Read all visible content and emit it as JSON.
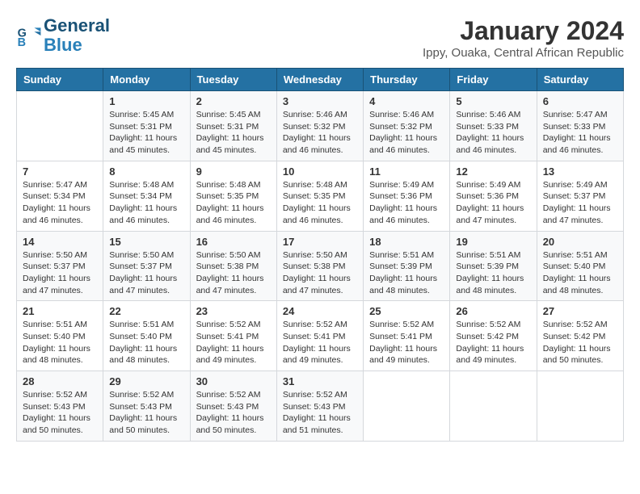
{
  "logo": {
    "line1": "General",
    "line2": "Blue"
  },
  "title": "January 2024",
  "subtitle": "Ippy, Ouaka, Central African Republic",
  "weekdays": [
    "Sunday",
    "Monday",
    "Tuesday",
    "Wednesday",
    "Thursday",
    "Friday",
    "Saturday"
  ],
  "weeks": [
    [
      {
        "day": "",
        "info": ""
      },
      {
        "day": "1",
        "info": "Sunrise: 5:45 AM\nSunset: 5:31 PM\nDaylight: 11 hours\nand 45 minutes."
      },
      {
        "day": "2",
        "info": "Sunrise: 5:45 AM\nSunset: 5:31 PM\nDaylight: 11 hours\nand 45 minutes."
      },
      {
        "day": "3",
        "info": "Sunrise: 5:46 AM\nSunset: 5:32 PM\nDaylight: 11 hours\nand 46 minutes."
      },
      {
        "day": "4",
        "info": "Sunrise: 5:46 AM\nSunset: 5:32 PM\nDaylight: 11 hours\nand 46 minutes."
      },
      {
        "day": "5",
        "info": "Sunrise: 5:46 AM\nSunset: 5:33 PM\nDaylight: 11 hours\nand 46 minutes."
      },
      {
        "day": "6",
        "info": "Sunrise: 5:47 AM\nSunset: 5:33 PM\nDaylight: 11 hours\nand 46 minutes."
      }
    ],
    [
      {
        "day": "7",
        "info": "Sunrise: 5:47 AM\nSunset: 5:34 PM\nDaylight: 11 hours\nand 46 minutes."
      },
      {
        "day": "8",
        "info": "Sunrise: 5:48 AM\nSunset: 5:34 PM\nDaylight: 11 hours\nand 46 minutes."
      },
      {
        "day": "9",
        "info": "Sunrise: 5:48 AM\nSunset: 5:35 PM\nDaylight: 11 hours\nand 46 minutes."
      },
      {
        "day": "10",
        "info": "Sunrise: 5:48 AM\nSunset: 5:35 PM\nDaylight: 11 hours\nand 46 minutes."
      },
      {
        "day": "11",
        "info": "Sunrise: 5:49 AM\nSunset: 5:36 PM\nDaylight: 11 hours\nand 46 minutes."
      },
      {
        "day": "12",
        "info": "Sunrise: 5:49 AM\nSunset: 5:36 PM\nDaylight: 11 hours\nand 47 minutes."
      },
      {
        "day": "13",
        "info": "Sunrise: 5:49 AM\nSunset: 5:37 PM\nDaylight: 11 hours\nand 47 minutes."
      }
    ],
    [
      {
        "day": "14",
        "info": "Sunrise: 5:50 AM\nSunset: 5:37 PM\nDaylight: 11 hours\nand 47 minutes."
      },
      {
        "day": "15",
        "info": "Sunrise: 5:50 AM\nSunset: 5:37 PM\nDaylight: 11 hours\nand 47 minutes."
      },
      {
        "day": "16",
        "info": "Sunrise: 5:50 AM\nSunset: 5:38 PM\nDaylight: 11 hours\nand 47 minutes."
      },
      {
        "day": "17",
        "info": "Sunrise: 5:50 AM\nSunset: 5:38 PM\nDaylight: 11 hours\nand 47 minutes."
      },
      {
        "day": "18",
        "info": "Sunrise: 5:51 AM\nSunset: 5:39 PM\nDaylight: 11 hours\nand 48 minutes."
      },
      {
        "day": "19",
        "info": "Sunrise: 5:51 AM\nSunset: 5:39 PM\nDaylight: 11 hours\nand 48 minutes."
      },
      {
        "day": "20",
        "info": "Sunrise: 5:51 AM\nSunset: 5:40 PM\nDaylight: 11 hours\nand 48 minutes."
      }
    ],
    [
      {
        "day": "21",
        "info": "Sunrise: 5:51 AM\nSunset: 5:40 PM\nDaylight: 11 hours\nand 48 minutes."
      },
      {
        "day": "22",
        "info": "Sunrise: 5:51 AM\nSunset: 5:40 PM\nDaylight: 11 hours\nand 48 minutes."
      },
      {
        "day": "23",
        "info": "Sunrise: 5:52 AM\nSunset: 5:41 PM\nDaylight: 11 hours\nand 49 minutes."
      },
      {
        "day": "24",
        "info": "Sunrise: 5:52 AM\nSunset: 5:41 PM\nDaylight: 11 hours\nand 49 minutes."
      },
      {
        "day": "25",
        "info": "Sunrise: 5:52 AM\nSunset: 5:41 PM\nDaylight: 11 hours\nand 49 minutes."
      },
      {
        "day": "26",
        "info": "Sunrise: 5:52 AM\nSunset: 5:42 PM\nDaylight: 11 hours\nand 49 minutes."
      },
      {
        "day": "27",
        "info": "Sunrise: 5:52 AM\nSunset: 5:42 PM\nDaylight: 11 hours\nand 50 minutes."
      }
    ],
    [
      {
        "day": "28",
        "info": "Sunrise: 5:52 AM\nSunset: 5:43 PM\nDaylight: 11 hours\nand 50 minutes."
      },
      {
        "day": "29",
        "info": "Sunrise: 5:52 AM\nSunset: 5:43 PM\nDaylight: 11 hours\nand 50 minutes."
      },
      {
        "day": "30",
        "info": "Sunrise: 5:52 AM\nSunset: 5:43 PM\nDaylight: 11 hours\nand 50 minutes."
      },
      {
        "day": "31",
        "info": "Sunrise: 5:52 AM\nSunset: 5:43 PM\nDaylight: 11 hours\nand 51 minutes."
      },
      {
        "day": "",
        "info": ""
      },
      {
        "day": "",
        "info": ""
      },
      {
        "day": "",
        "info": ""
      }
    ]
  ]
}
